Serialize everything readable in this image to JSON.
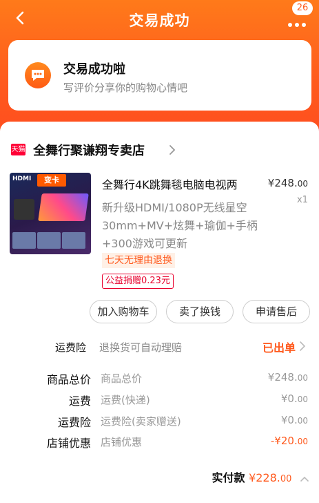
{
  "header": {
    "title": "交易成功",
    "message_badge": "26"
  },
  "success": {
    "title": "交易成功啦",
    "subtitle": "写评价分享你的购物心情吧"
  },
  "store": {
    "tag": "天猫",
    "name": "全舞行聚谦翔专卖店"
  },
  "product": {
    "title": "全舞行4K跳舞毯电脑电视两",
    "description": "新升级HDMI/1080P无线星空30mm+MV+炫舞+瑜伽+手柄+300游戏可更新",
    "price_symbol": "¥",
    "price_int": "248.",
    "price_dec": "00",
    "quantity": "x1",
    "tag_return": "七天无理由退换",
    "tag_charity": "公益捐赠0.23元",
    "image_text": {
      "hdmi": "HDMI",
      "badge": "变卡"
    }
  },
  "actions": [
    {
      "label": "加入购物车"
    },
    {
      "label": "卖了换钱"
    },
    {
      "label": "申请售后"
    }
  ],
  "insurance": {
    "label": "运费险",
    "desc": "退换货可自动理赔",
    "status": "已出单"
  },
  "fees": [
    {
      "label": "商品总价",
      "name": "商品总价",
      "symbol": "¥",
      "int": "248.",
      "dec": "00"
    },
    {
      "label": "运费",
      "name": "运费(快递)",
      "symbol": "¥",
      "int": "0.",
      "dec": "00"
    },
    {
      "label": "运费险",
      "name": "运费险(卖家赠送)",
      "symbol": "¥",
      "int": "0.",
      "dec": "00"
    },
    {
      "label": "店铺优惠",
      "name": "店铺优惠",
      "symbol": "-¥",
      "int": "20.",
      "dec": "00"
    }
  ],
  "paid": {
    "label": "实付款",
    "symbol": "¥",
    "int": "228.",
    "dec": "00"
  },
  "colors": {
    "accent": "#ff5a1e",
    "header_gradient_start": "#ff7a1a",
    "tmall_red": "#ff0036"
  }
}
